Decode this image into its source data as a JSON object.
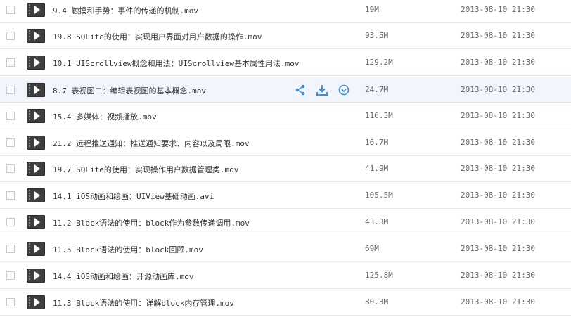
{
  "colors": {
    "accent": "#3b8fd9",
    "row_hover": "#f2f5fb",
    "divider": "#e6e6e6"
  },
  "files": [
    {
      "name": "9.4 触摸和手势：事件的传递的机制.mov",
      "size": "19M",
      "date": "2013-08-10 21:30",
      "icon": "video-file-icon"
    },
    {
      "name": "19.8 SQLite的使用：实现用户界面对用户数据的操作.mov",
      "size": "93.5M",
      "date": "2013-08-10 21:30",
      "icon": "video-file-icon"
    },
    {
      "name": "10.1 UIScrollview概念和用法：UIScrollview基本属性用法.mov",
      "size": "129.2M",
      "date": "2013-08-10 21:30",
      "icon": "video-file-icon"
    },
    {
      "name": "8.7 表视图二：编辑表视图的基本概念.mov",
      "size": "24.7M",
      "date": "2013-08-10 21:30",
      "icon": "video-file-icon",
      "hovered": true
    },
    {
      "name": "15.4 多媒体：视频播放.mov",
      "size": "116.3M",
      "date": "2013-08-10 21:30",
      "icon": "video-file-icon"
    },
    {
      "name": "21.2 远程推送通知：推送通知要求、内容以及局限.mov",
      "size": "16.7M",
      "date": "2013-08-10 21:30",
      "icon": "video-file-icon"
    },
    {
      "name": "19.7 SQLite的使用：实现操作用户数据管理类.mov",
      "size": "41.9M",
      "date": "2013-08-10 21:30",
      "icon": "video-file-icon"
    },
    {
      "name": "14.1 iOS动画和绘画：UIView基础动画.avi",
      "size": "105.5M",
      "date": "2013-08-10 21:30",
      "icon": "video-file-icon"
    },
    {
      "name": "11.2 Block语法的使用：block作为参数传递调用.mov",
      "size": "43.3M",
      "date": "2013-08-10 21:30",
      "icon": "video-file-icon"
    },
    {
      "name": "11.5 Block语法的使用：block回顾.mov",
      "size": "69M",
      "date": "2013-08-10 21:30",
      "icon": "video-file-icon"
    },
    {
      "name": "14.4 iOS动画和绘画：开源动画库.mov",
      "size": "125.8M",
      "date": "2013-08-10 21:30",
      "icon": "video-file-icon"
    },
    {
      "name": "11.3 Block语法的使用：详解block内存管理.mov",
      "size": "80.3M",
      "date": "2013-08-10 21:30",
      "icon": "video-file-icon"
    }
  ],
  "row_actions": [
    "share-icon",
    "download-icon",
    "more-dropdown-icon"
  ]
}
